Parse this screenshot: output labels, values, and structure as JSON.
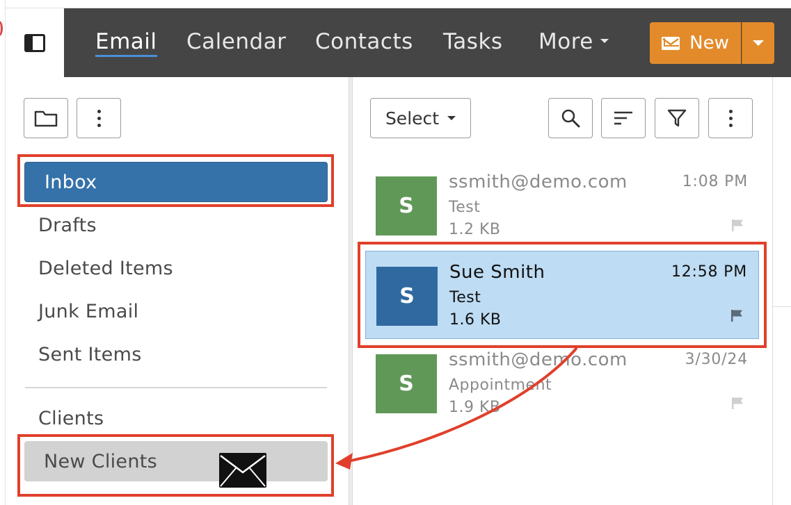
{
  "nav": {
    "items": [
      {
        "label": "Email",
        "active": true
      },
      {
        "label": "Calendar"
      },
      {
        "label": "Contacts"
      },
      {
        "label": "Tasks"
      },
      {
        "label": "More"
      }
    ],
    "new_label": "New"
  },
  "folders": {
    "items": [
      {
        "label": "Inbox",
        "state": "selected"
      },
      {
        "label": "Drafts"
      },
      {
        "label": "Deleted Items"
      },
      {
        "label": "Junk Email"
      },
      {
        "label": "Sent Items"
      }
    ],
    "custom": [
      {
        "label": "Clients"
      },
      {
        "label": "New Clients",
        "state": "drop-target"
      }
    ]
  },
  "list": {
    "select_label": "Select",
    "messages": [
      {
        "avatar": "S",
        "from": "ssmith@demo.com",
        "subject": "Test",
        "size": "1.2 KB",
        "time": "1:08 PM",
        "avatar_color": "#609858"
      },
      {
        "avatar": "S",
        "from": "Sue Smith",
        "subject": "Test",
        "size": "1.6 KB",
        "time": "12:58 PM",
        "avatar_color": "#2f69a0",
        "selected": true
      },
      {
        "avatar": "S",
        "from": "ssmith@demo.com",
        "subject": "Appointment",
        "size": "1.9 KB",
        "time": "3/30/24",
        "avatar_color": "#609858"
      }
    ]
  },
  "colors": {
    "navbar": "#454545",
    "accent_new": "#e38b2b",
    "folder_selected": "#3572a9",
    "message_selected": "#bedcf3",
    "annotation": "#e0402b"
  },
  "icons": {
    "sidebar_toggle": "sidebar-toggle-icon",
    "folder": "folder-icon",
    "more": "more-vertical-icon",
    "search": "search-icon",
    "sort": "sort-icon",
    "filter": "filter-icon",
    "flag": "flag-icon",
    "envelope": "envelope-icon"
  }
}
